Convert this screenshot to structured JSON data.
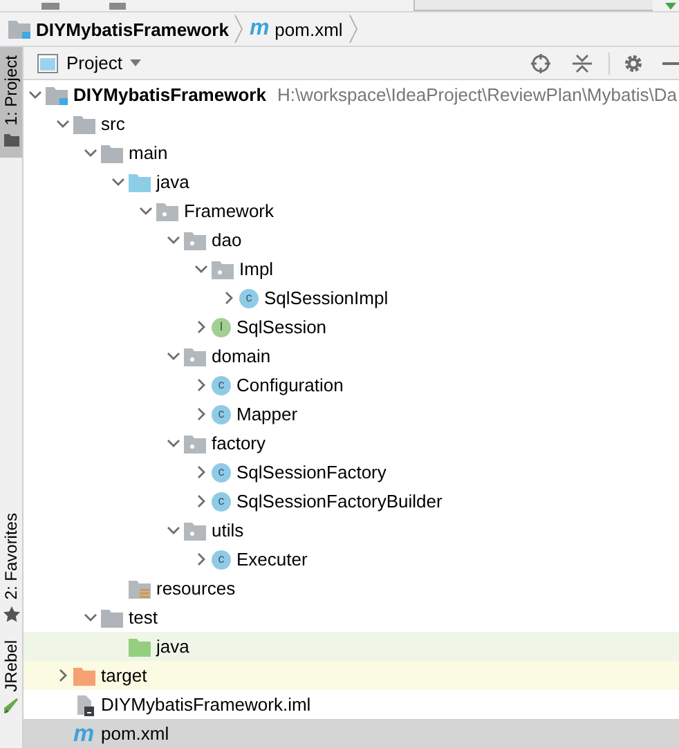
{
  "breadcrumbs": [
    {
      "kind": "module",
      "label": "DIYMybatisFramework"
    },
    {
      "kind": "maven",
      "icon": "m",
      "label": "pom.xml"
    }
  ],
  "side_tabs": [
    {
      "kind": "project",
      "label": "1: Project",
      "selected": true
    },
    {
      "kind": "favorites",
      "label": "2: Favorites",
      "selected": false
    },
    {
      "kind": "jrebel",
      "label": "JRebel",
      "selected": false
    }
  ],
  "tool_window": {
    "title": "Project"
  },
  "tree": [
    {
      "kind": "module",
      "label": "DIYMybatisFramework",
      "path": "H:\\workspace\\IdeaProject\\ReviewPlan\\Mybatis\\Da",
      "expanded": true,
      "selected": false,
      "children": [
        {
          "kind": "folder",
          "label": "src",
          "expanded": true,
          "selected": false,
          "children": [
            {
              "kind": "folder",
              "label": "main",
              "expanded": true,
              "selected": false,
              "children": [
                {
                  "kind": "source",
                  "label": "java",
                  "expanded": true,
                  "selected": false,
                  "children": [
                    {
                      "kind": "package",
                      "label": "Framework",
                      "expanded": true,
                      "selected": false,
                      "children": [
                        {
                          "kind": "package",
                          "label": "dao",
                          "expanded": true,
                          "selected": false,
                          "children": [
                            {
                              "kind": "package",
                              "label": "Impl",
                              "expanded": true,
                              "selected": false,
                              "children": [
                                {
                                  "kind": "class",
                                  "badge": "c",
                                  "label": "SqlSessionImpl",
                                  "expanded": false,
                                  "selected": false
                                }
                              ]
                            },
                            {
                              "kind": "interface",
                              "badge": "I",
                              "label": "SqlSession",
                              "expanded": false,
                              "selected": false
                            }
                          ]
                        },
                        {
                          "kind": "package",
                          "label": "domain",
                          "expanded": true,
                          "selected": false,
                          "children": [
                            {
                              "kind": "class",
                              "badge": "c",
                              "label": "Configuration",
                              "expanded": false,
                              "selected": false
                            },
                            {
                              "kind": "class",
                              "badge": "c",
                              "label": "Mapper",
                              "expanded": false,
                              "selected": false
                            }
                          ]
                        },
                        {
                          "kind": "package",
                          "label": "factory",
                          "expanded": true,
                          "selected": false,
                          "children": [
                            {
                              "kind": "class",
                              "badge": "c",
                              "label": "SqlSessionFactory",
                              "expanded": false,
                              "selected": false
                            },
                            {
                              "kind": "class",
                              "badge": "c",
                              "label": "SqlSessionFactoryBuilder",
                              "expanded": false,
                              "selected": false
                            }
                          ]
                        },
                        {
                          "kind": "package",
                          "label": "utils",
                          "expanded": true,
                          "selected": false,
                          "children": [
                            {
                              "kind": "class",
                              "badge": "c",
                              "label": "Executer",
                              "expanded": false,
                              "selected": false
                            }
                          ]
                        }
                      ]
                    }
                  ]
                },
                {
                  "kind": "resources",
                  "label": "resources",
                  "selected": false
                }
              ]
            },
            {
              "kind": "folder",
              "label": "test",
              "expanded": true,
              "selected": false,
              "children": [
                {
                  "kind": "test-source",
                  "label": "java",
                  "selected": false
                }
              ]
            }
          ]
        },
        {
          "kind": "excluded",
          "label": "target",
          "expanded": false,
          "selected": false
        },
        {
          "kind": "iml",
          "label": "DIYMybatisFramework.iml",
          "selected": false
        },
        {
          "kind": "maven",
          "icon": "m",
          "label": "pom.xml",
          "selected": true
        }
      ]
    }
  ]
}
